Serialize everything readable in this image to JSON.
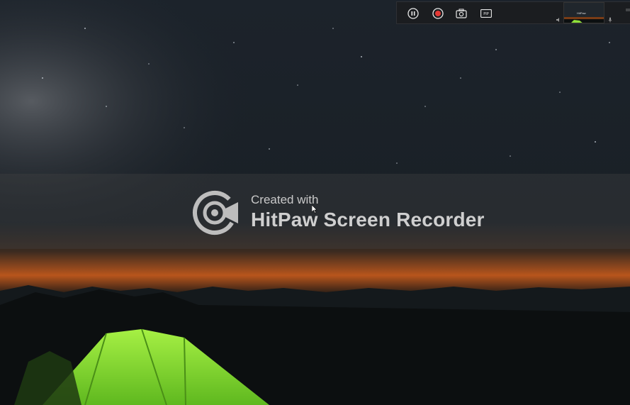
{
  "watermark": {
    "line1": "Created with",
    "line2": "HitPaw Screen Recorder"
  },
  "toolbar": {
    "buttons": [
      {
        "name": "pause",
        "icon": "pause-icon"
      },
      {
        "name": "record",
        "icon": "record-stop-icon"
      },
      {
        "name": "screenshot",
        "icon": "camera-icon"
      },
      {
        "name": "pip",
        "icon": "pip-icon",
        "label": "PIP"
      }
    ],
    "pip_preview": {
      "label": "HitPaw"
    }
  },
  "colors": {
    "record_red": "#e53935",
    "tent_green": "#8fe03a",
    "horizon_orange": "#e2732a",
    "sky": "#1a2129"
  }
}
